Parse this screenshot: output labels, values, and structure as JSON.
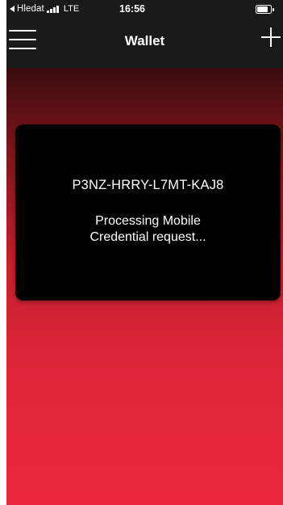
{
  "status_bar": {
    "back_app_label": "Hledat",
    "network_type": "LTE",
    "time": "16:56",
    "signal_bars_filled": 4,
    "battery_level": 0.85,
    "back_icon": "back-arrow-icon"
  },
  "nav": {
    "title": "Wallet",
    "menu_icon": "hamburger-menu-icon",
    "add_icon": "plus-icon"
  },
  "card": {
    "credential_code": "P3NZ-HRRY-L7MT-KAJ8",
    "status_line_1": "Processing Mobile",
    "status_line_2": "Credential request..."
  },
  "colors": {
    "bar_background": "#1a1a1a",
    "gradient_top": "#390c0e",
    "gradient_bottom": "#ec283c",
    "card_background": "#000000",
    "text": "#ffffff"
  }
}
